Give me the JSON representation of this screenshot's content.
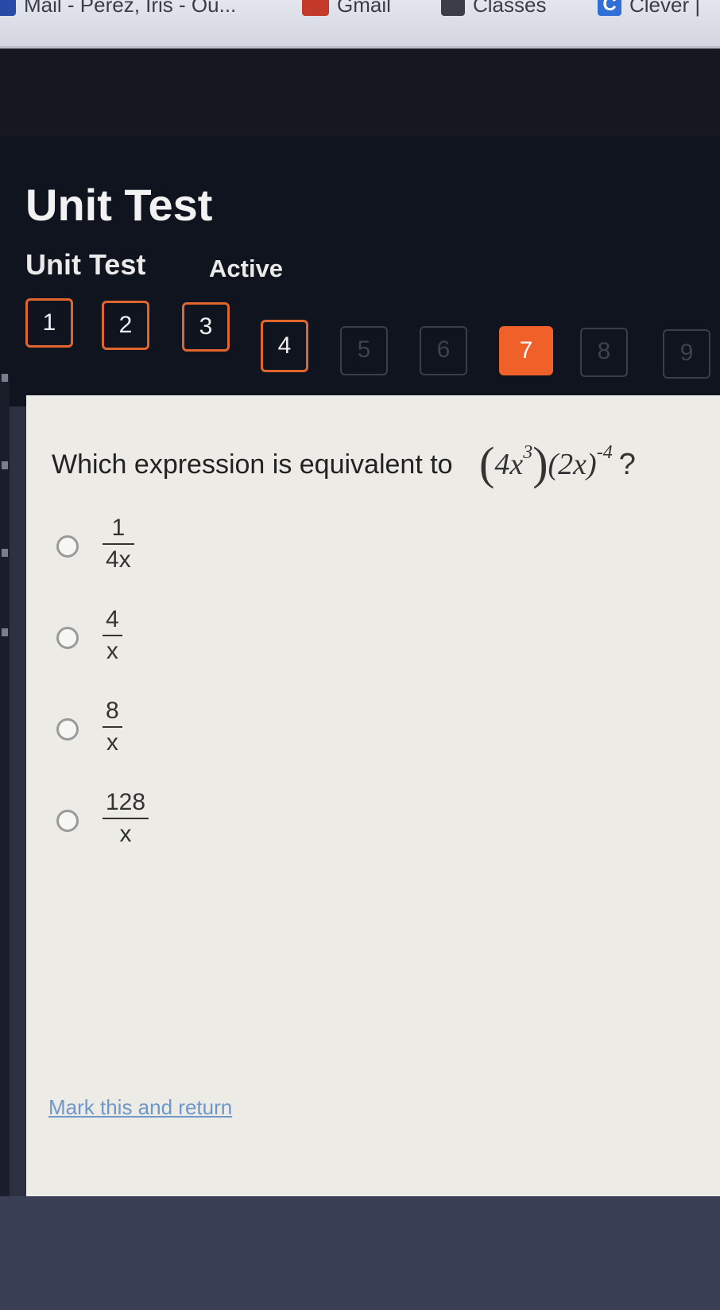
{
  "bookmarks": [
    {
      "label": "Mail - Perez, Iris - Ou...",
      "icon": "mail-icon"
    },
    {
      "label": "Gmail",
      "icon": "gmail-icon"
    },
    {
      "label": "Classes",
      "icon": "classes-icon"
    },
    {
      "label": "Clever |",
      "icon": "clever-icon",
      "icon_letter": "C"
    }
  ],
  "header": {
    "title": "Unit Test",
    "subtitle": "Unit Test",
    "status": "Active"
  },
  "question_nav": {
    "items": [
      {
        "label": "1",
        "state": "answered"
      },
      {
        "label": "2",
        "state": "answered"
      },
      {
        "label": "3",
        "state": "answered"
      },
      {
        "label": "4",
        "state": "answered"
      },
      {
        "label": "5",
        "state": "locked"
      },
      {
        "label": "6",
        "state": "locked"
      },
      {
        "label": "7",
        "state": "current"
      },
      {
        "label": "8",
        "state": "locked"
      },
      {
        "label": "9",
        "state": "locked"
      }
    ],
    "accent": "#f0612a"
  },
  "question": {
    "prompt": "Which expression is equivalent to",
    "expression": {
      "open_paren": "(",
      "base1": "4x",
      "exp1": "3",
      "close_paren": ")",
      "factor2": "(2x)",
      "exp2": "-4",
      "end": "?"
    },
    "options": [
      {
        "numerator": "1",
        "denominator": "4x"
      },
      {
        "numerator": "4",
        "denominator": "x"
      },
      {
        "numerator": "8",
        "denominator": "x"
      },
      {
        "numerator": "128",
        "denominator": "x"
      }
    ]
  },
  "footer": {
    "mark_link": "Mark this and return"
  }
}
